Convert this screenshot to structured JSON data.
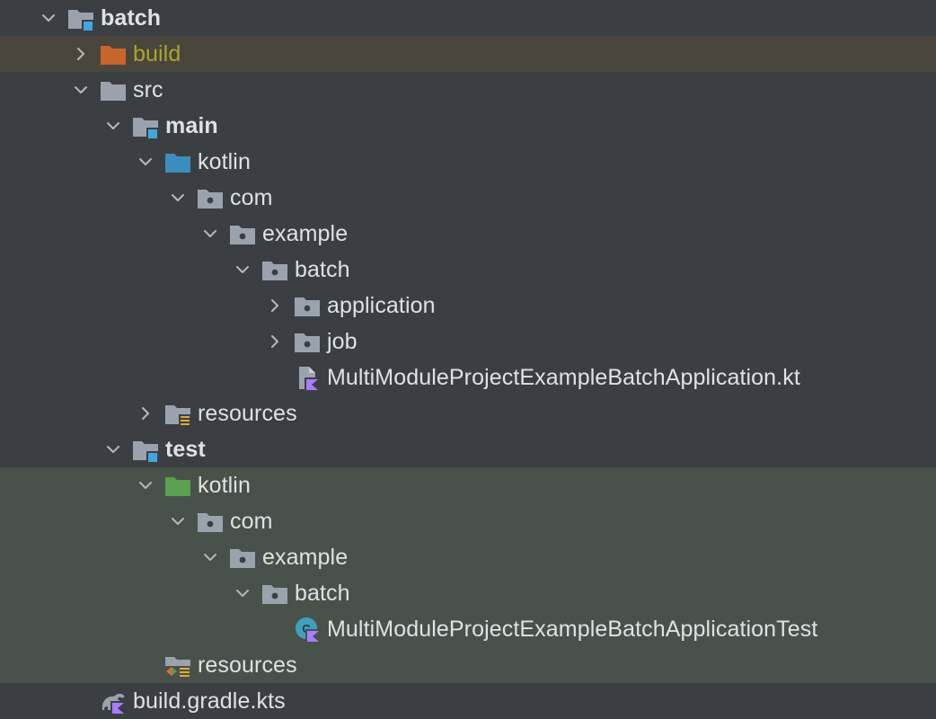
{
  "tree": {
    "nodes": [
      {
        "label": "batch",
        "depth": 0,
        "expander": "expanded",
        "icon": "module-folder-icon",
        "bold": true,
        "state": "normal"
      },
      {
        "label": "build",
        "depth": 1,
        "expander": "collapsed",
        "icon": "excluded-folder-icon",
        "bold": false,
        "state": "excluded"
      },
      {
        "label": "src",
        "depth": 1,
        "expander": "expanded",
        "icon": "folder-icon",
        "bold": false,
        "state": "normal"
      },
      {
        "label": "main",
        "depth": 2,
        "expander": "expanded",
        "icon": "module-folder-icon",
        "bold": true,
        "state": "normal"
      },
      {
        "label": "kotlin",
        "depth": 3,
        "expander": "expanded",
        "icon": "source-root-folder-icon",
        "bold": false,
        "state": "normal"
      },
      {
        "label": "com",
        "depth": 4,
        "expander": "expanded",
        "icon": "package-icon",
        "bold": false,
        "state": "normal"
      },
      {
        "label": "example",
        "depth": 5,
        "expander": "expanded",
        "icon": "package-icon",
        "bold": false,
        "state": "normal"
      },
      {
        "label": "batch",
        "depth": 6,
        "expander": "expanded",
        "icon": "package-icon",
        "bold": false,
        "state": "normal"
      },
      {
        "label": "application",
        "depth": 7,
        "expander": "collapsed",
        "icon": "package-icon",
        "bold": false,
        "state": "normal"
      },
      {
        "label": "job",
        "depth": 7,
        "expander": "collapsed",
        "icon": "package-icon",
        "bold": false,
        "state": "normal"
      },
      {
        "label": "MultiModuleProjectExampleBatchApplication.kt",
        "depth": 7,
        "expander": "none",
        "icon": "kotlin-file-icon",
        "bold": false,
        "state": "normal"
      },
      {
        "label": "resources",
        "depth": 3,
        "expander": "collapsed",
        "icon": "resources-folder-icon",
        "bold": false,
        "state": "normal"
      },
      {
        "label": "test",
        "depth": 2,
        "expander": "expanded",
        "icon": "module-folder-icon",
        "bold": true,
        "state": "normal"
      },
      {
        "label": "kotlin",
        "depth": 3,
        "expander": "expanded",
        "icon": "test-source-root-folder-icon",
        "bold": false,
        "state": "test"
      },
      {
        "label": "com",
        "depth": 4,
        "expander": "expanded",
        "icon": "package-icon",
        "bold": false,
        "state": "test"
      },
      {
        "label": "example",
        "depth": 5,
        "expander": "expanded",
        "icon": "package-icon",
        "bold": false,
        "state": "test"
      },
      {
        "label": "batch",
        "depth": 6,
        "expander": "expanded",
        "icon": "package-icon",
        "bold": false,
        "state": "test"
      },
      {
        "label": "MultiModuleProjectExampleBatchApplicationTest",
        "depth": 7,
        "expander": "none",
        "icon": "kotlin-test-class-icon",
        "bold": false,
        "state": "test"
      },
      {
        "label": "resources",
        "depth": 3,
        "expander": "none",
        "icon": "test-resources-folder-icon",
        "bold": false,
        "state": "test"
      },
      {
        "label": "build.gradle.kts",
        "depth": 1,
        "expander": "none",
        "icon": "gradle-kts-file-icon",
        "bold": false,
        "state": "normal"
      }
    ]
  },
  "colors": {
    "background": "#3b3f43",
    "excluded_row": "#4b463b",
    "test_row": "#48524a",
    "text": "#dfe1e5",
    "excluded_text": "#a7a72c",
    "folder_gray": "#9aa3ad",
    "module_badge": "#3fa7e0",
    "source_root": "#3c8dbc",
    "test_root": "#59a14f",
    "excluded_folder": "#c8652c",
    "kotlin_purple": "#a97bff"
  }
}
